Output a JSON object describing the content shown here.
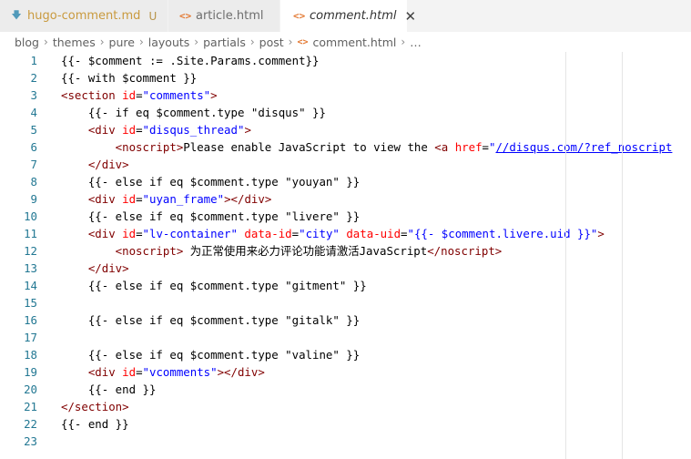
{
  "tabs": [
    {
      "label": "hugo-comment.md",
      "status": "U",
      "icon": "download-arrow-icon"
    },
    {
      "label": "article.html",
      "icon": "html-angle-icon"
    },
    {
      "label": "comment.html",
      "icon": "html-angle-icon",
      "active": true,
      "close": "✕"
    }
  ],
  "breadcrumb": {
    "items": [
      "blog",
      "themes",
      "pure",
      "layouts",
      "partials",
      "post",
      "comment.html"
    ],
    "separator": "›",
    "ellipsis": "…"
  },
  "editor": {
    "line_numbers": [
      "1",
      "2",
      "3",
      "4",
      "5",
      "6",
      "7",
      "8",
      "9",
      "10",
      "11",
      "12",
      "13",
      "14",
      "15",
      "16",
      "17",
      "18",
      "19",
      "20",
      "21",
      "22",
      "23"
    ],
    "lines": [
      [
        {
          "t": "{{- $comment := .Site.Params.comment}}",
          "c": "tpl"
        }
      ],
      [
        {
          "t": "{{- with $comment }}",
          "c": "tpl"
        }
      ],
      [
        {
          "t": "<section ",
          "c": "tag"
        },
        {
          "t": "id",
          "c": "attr"
        },
        {
          "t": "=",
          "c": "text"
        },
        {
          "t": "\"comments\"",
          "c": "val"
        },
        {
          "t": ">",
          "c": "tag"
        }
      ],
      [
        {
          "t": "    {{- if eq $comment.type \"disqus\" }}",
          "c": "tpl"
        }
      ],
      [
        {
          "t": "    <div ",
          "c": "tag"
        },
        {
          "t": "id",
          "c": "attr"
        },
        {
          "t": "=",
          "c": "text"
        },
        {
          "t": "\"disqus_thread\"",
          "c": "val"
        },
        {
          "t": ">",
          "c": "tag"
        }
      ],
      [
        {
          "t": "        <noscript>",
          "c": "tag"
        },
        {
          "t": "Please enable JavaScript to view the ",
          "c": "text"
        },
        {
          "t": "<a ",
          "c": "tag"
        },
        {
          "t": "href",
          "c": "attr"
        },
        {
          "t": "=",
          "c": "text"
        },
        {
          "t": "\"",
          "c": "val"
        },
        {
          "t": "//disqus.com/?ref_noscript",
          "c": "url"
        }
      ],
      [
        {
          "t": "    </div>",
          "c": "tag"
        }
      ],
      [
        {
          "t": "    {{- else if eq $comment.type \"youyan\" }}",
          "c": "tpl"
        }
      ],
      [
        {
          "t": "    <div ",
          "c": "tag"
        },
        {
          "t": "id",
          "c": "attr"
        },
        {
          "t": "=",
          "c": "text"
        },
        {
          "t": "\"uyan_frame\"",
          "c": "val"
        },
        {
          "t": "></div>",
          "c": "tag"
        }
      ],
      [
        {
          "t": "    {{- else if eq $comment.type \"livere\" }}",
          "c": "tpl"
        }
      ],
      [
        {
          "t": "    <div ",
          "c": "tag"
        },
        {
          "t": "id",
          "c": "attr"
        },
        {
          "t": "=",
          "c": "text"
        },
        {
          "t": "\"lv-container\"",
          "c": "val"
        },
        {
          "t": " data-id",
          "c": "attr"
        },
        {
          "t": "=",
          "c": "text"
        },
        {
          "t": "\"city\"",
          "c": "val"
        },
        {
          "t": " data-uid",
          "c": "attr"
        },
        {
          "t": "=",
          "c": "text"
        },
        {
          "t": "\"{{- $comment.livere.uid }}\"",
          "c": "val"
        },
        {
          "t": ">",
          "c": "tag"
        }
      ],
      [
        {
          "t": "        <noscript>",
          "c": "tag"
        },
        {
          "t": " 为正常使用来必力评论功能请激活JavaScript",
          "c": "text"
        },
        {
          "t": "</noscript>",
          "c": "tag"
        }
      ],
      [
        {
          "t": "    </div>",
          "c": "tag"
        }
      ],
      [
        {
          "t": "    {{- else if eq $comment.type \"gitment\" }}",
          "c": "tpl"
        }
      ],
      [],
      [
        {
          "t": "    {{- else if eq $comment.type \"gitalk\" }}",
          "c": "tpl"
        }
      ],
      [],
      [
        {
          "t": "    {{- else if eq $comment.type \"valine\" }}",
          "c": "tpl"
        }
      ],
      [
        {
          "t": "    <div ",
          "c": "tag"
        },
        {
          "t": "id",
          "c": "attr"
        },
        {
          "t": "=",
          "c": "text"
        },
        {
          "t": "\"vcomments\"",
          "c": "val"
        },
        {
          "t": "></div>",
          "c": "tag"
        }
      ],
      [
        {
          "t": "    {{- end }}",
          "c": "tpl"
        }
      ],
      [
        {
          "t": "</section>",
          "c": "tag"
        }
      ],
      [
        {
          "t": "{{- end }}",
          "c": "tpl"
        }
      ],
      []
    ]
  },
  "colors": {
    "tag": "#800000",
    "attr": "#ff0000",
    "value": "#0000ff",
    "line_number": "#237893",
    "html_icon": "#e37933",
    "md_icon": "#519aba",
    "untracked": "#b8944a"
  }
}
